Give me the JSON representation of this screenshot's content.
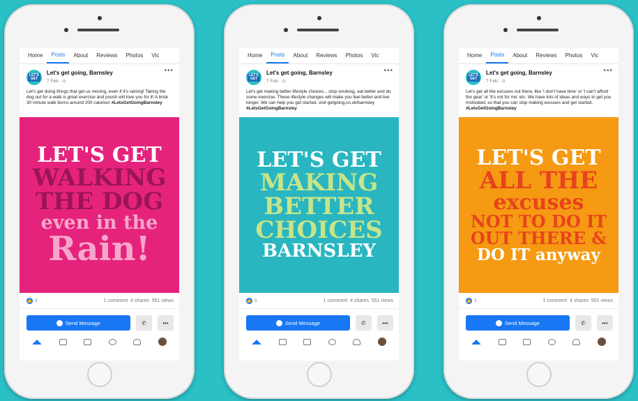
{
  "phones": [
    {
      "tabs": [
        "Home",
        "Posts",
        "About",
        "Reviews",
        "Photos",
        "Vic"
      ],
      "page_name": "Let's get going, Barnsley",
      "post_date": "7 Feb · ⊙",
      "post_text": "Let's get doing things that get us moving, even if it's raining! Taking the dog out for a walk is great exercise and pooch will love you for it! A brisk 30 minute walk burns around 200 calories! ",
      "hashtag": "#LetsGetGoingBarnsley",
      "poster_bg": "#e6237c",
      "poster_lines": [
        {
          "text": "LET'S GET",
          "color": "#ffffff"
        },
        {
          "text": "WALKING",
          "color": "#9b1555"
        },
        {
          "text": "THE DOG",
          "color": "#9b1555"
        },
        {
          "text": "even in the",
          "color": "#f6a6cc"
        },
        {
          "text": "Rain!",
          "color": "#f6a6cc"
        }
      ],
      "like_count": "1",
      "comments": "1 comment",
      "shares": "4 shares",
      "views": "551 views",
      "send_label": "Send Message"
    },
    {
      "tabs": [
        "Home",
        "Posts",
        "About",
        "Reviews",
        "Photos",
        "Vic"
      ],
      "page_name": "Let's get going, Barnsley",
      "post_date": "7 Feb · ⊙",
      "post_text": "Let's get making better lifestyle choices... stop smoking, eat better and do some exercise. These lifestyle changes will make you feel better and live longer. We can help you get started, visit getgoing.co.uk/barnsley ",
      "hashtag": "#LetsGetGoingBarnsley",
      "poster_bg": "#2ab6c0",
      "poster_lines": [
        {
          "text": "LET'S GET",
          "color": "#ffffff"
        },
        {
          "text": "MAKING",
          "color": "#c6e58a"
        },
        {
          "text": "BETTER",
          "color": "#c6e58a"
        },
        {
          "text": "CHOICES",
          "color": "#c6e58a"
        },
        {
          "text": "BARNSLEY",
          "color": "#ffffff"
        }
      ],
      "like_count": "1",
      "comments": "1 comment",
      "shares": "4 shares",
      "views": "551 views",
      "send_label": "Send Message"
    },
    {
      "tabs": [
        "Home",
        "Posts",
        "About",
        "Reviews",
        "Photos",
        "Vic"
      ],
      "page_name": "Let's get going, Barnsley",
      "post_date": "7 Feb · ⊙",
      "post_text": "Let's get all the excuses out there, like 'I don't have time' or 'I can't afford the gear' or 'It's not for me' etc. We have lots of ideas and ways to get you motivated, so that you can stop making excuses and get started. ",
      "hashtag": "#LetsGetGoingBarnsley",
      "poster_bg": "#f59a12",
      "poster_lines": [
        {
          "text": "LET'S GET",
          "color": "#ffffff"
        },
        {
          "text": "ALL THE",
          "color": "#e8431d"
        },
        {
          "text": "excuses",
          "color": "#e8431d"
        },
        {
          "text": "NOT TO DO IT",
          "color": "#e8431d"
        },
        {
          "text": "OUT THERE &",
          "color": "#e8431d"
        },
        {
          "text": "DO IT anyway",
          "color": "#ffffff"
        }
      ],
      "like_count": "1",
      "comments": "1 comment",
      "shares": "4 shares",
      "views": "551 views",
      "send_label": "Send Message"
    }
  ],
  "colors": {
    "background": "#2bbfc6",
    "facebook_blue": "#1877f2"
  }
}
